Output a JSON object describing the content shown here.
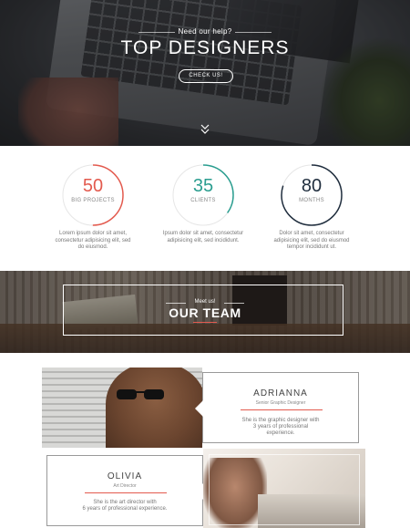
{
  "hero": {
    "kicker": "Need our help?",
    "title": "TOP DESIGNERS",
    "button_label": "CHECK US!"
  },
  "stats": [
    {
      "value": "50",
      "label": "BIG PROJECTS",
      "color": "#e35a4e",
      "fraction": 0.5,
      "description": "Lorem ipsum dolor sit amet, consectetur adipisicing elit, sed do eiusmod."
    },
    {
      "value": "35",
      "label": "CLIENTS",
      "color": "#2a9d8f",
      "fraction": 0.35,
      "description": "Ipsum dolor sit amet, consectetur adipisicing elit, sed incididunt."
    },
    {
      "value": "80",
      "label": "MONTHS",
      "color": "#1f2d3d",
      "fraction": 0.8,
      "description": "Dolor sit amet, consectetur adipisicing elit, sed do eiusmod tempor incididunt ut."
    }
  ],
  "team_banner": {
    "kicker": "Meet us!",
    "title": "OUR TEAM"
  },
  "members": [
    {
      "name": "ADRIANNA",
      "role": "Senior Graphic Designer",
      "bio_line1": "She is the graphic designer with",
      "bio_line2": "3 years of professional",
      "bio_line3": "experience."
    },
    {
      "name": "OLIVIA",
      "role": "Art Director",
      "bio_line1": "She is the art director with",
      "bio_line2": "6 years of professional experience.",
      "bio_line3": ""
    }
  ],
  "colors": {
    "accent": "#e35a4e",
    "teal": "#2a9d8f",
    "navy": "#1f2d3d"
  }
}
